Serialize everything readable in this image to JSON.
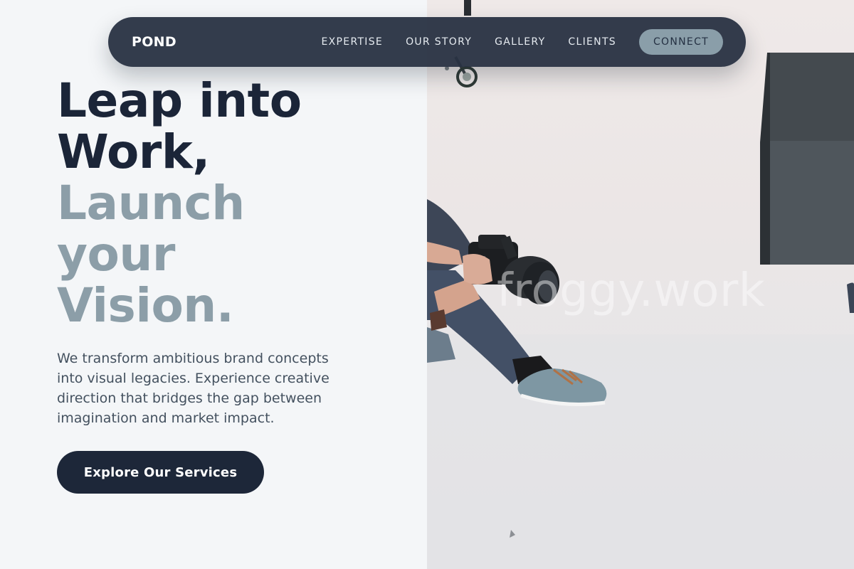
{
  "brand": {
    "name": "POND"
  },
  "nav": {
    "links": [
      "EXPERTISE",
      "OUR STORY",
      "GALLERY",
      "CLIENTS"
    ],
    "cta_label": "CONNECT"
  },
  "hero": {
    "headline_line1": "Leap into",
    "headline_line2": "Work,",
    "headline_line3": "Launch",
    "headline_line4": "your",
    "headline_line5": "Vision.",
    "description": "We transform ambitious brand concepts into visual legacies. Experience creative direction that bridges the gap between imagination and market impact.",
    "cta_label": "Explore Our Services"
  },
  "photo": {
    "watermark": "froggy.work",
    "subject": "photographer-with-camera"
  },
  "colors": {
    "page_bg": "#f4f6f8",
    "navbar_bg": "#283242",
    "heading_dark": "#1b2538",
    "heading_muted": "#8c9ea8",
    "button_dark": "#1d2739",
    "connect_bg": "#8a9ea9"
  }
}
